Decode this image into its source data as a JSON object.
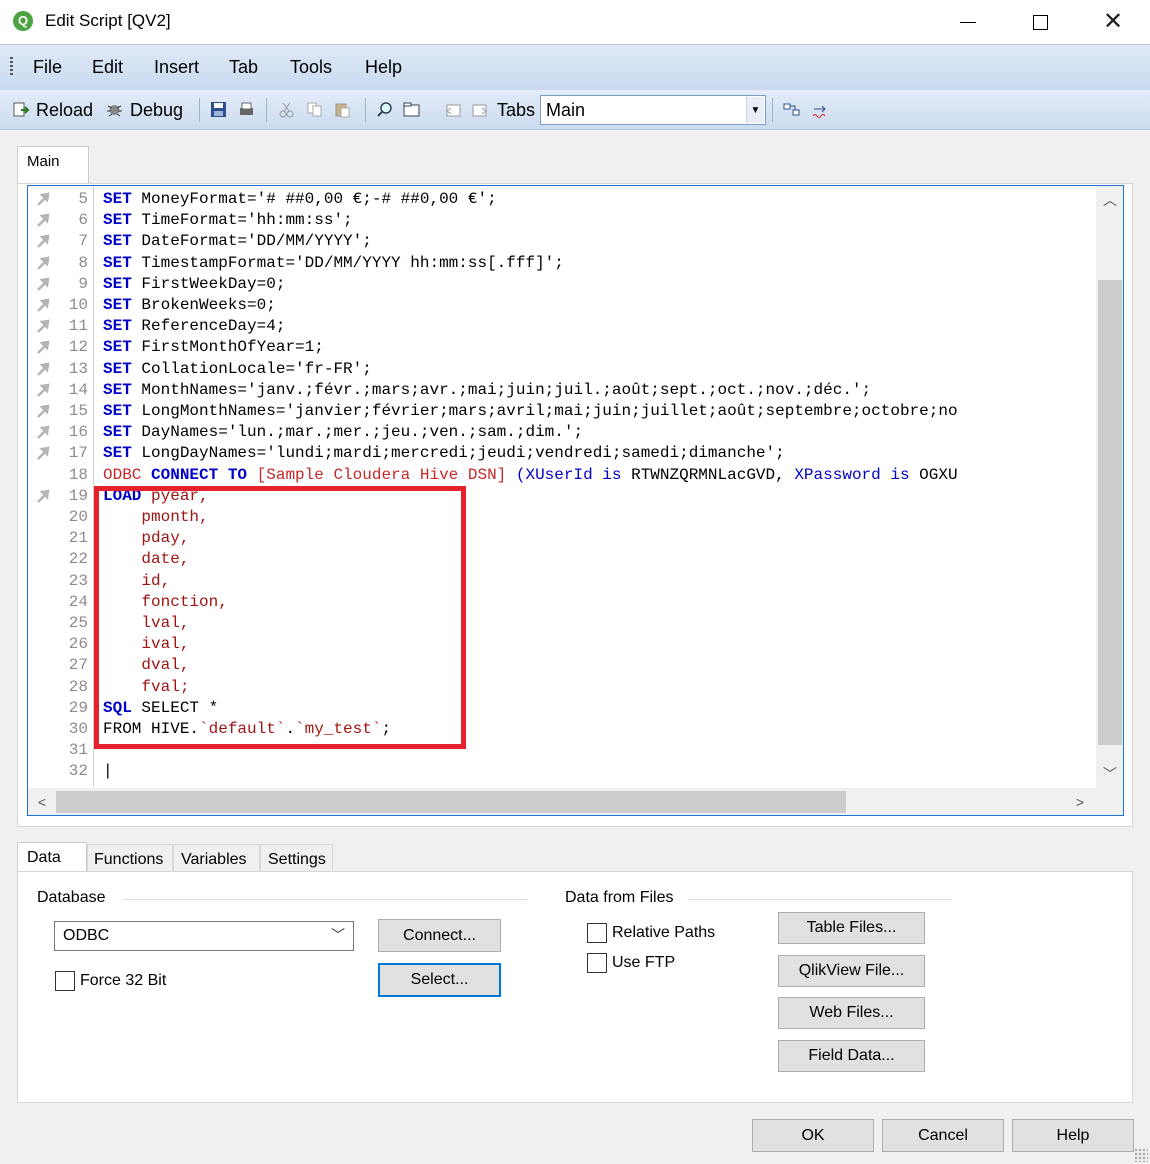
{
  "window": {
    "title": "Edit Script [QV2]",
    "app_icon_glyph": "Q"
  },
  "menu": [
    "File",
    "Edit",
    "Insert",
    "Tab",
    "Tools",
    "Help"
  ],
  "toolbar": {
    "reload_label": "Reload",
    "debug_label": "Debug",
    "tabs_label": "Tabs",
    "tab_select_value": "Main"
  },
  "editor": {
    "active_tab": "Main",
    "lines": [
      {
        "n": "5",
        "parts": [
          [
            "kw",
            "SET"
          ],
          [
            "plain",
            " MoneyFormat='# ##0,00 €;-# ##0,00 €';"
          ]
        ]
      },
      {
        "n": "6",
        "parts": [
          [
            "kw",
            "SET"
          ],
          [
            "plain",
            " TimeFormat='hh:mm:ss';"
          ]
        ]
      },
      {
        "n": "7",
        "parts": [
          [
            "kw",
            "SET"
          ],
          [
            "plain",
            " DateFormat='DD/MM/YYYY';"
          ]
        ]
      },
      {
        "n": "8",
        "parts": [
          [
            "kw",
            "SET"
          ],
          [
            "plain",
            " TimestampFormat='DD/MM/YYYY hh:mm:ss[.fff]';"
          ]
        ]
      },
      {
        "n": "9",
        "parts": [
          [
            "kw",
            "SET"
          ],
          [
            "plain",
            " FirstWeekDay=0;"
          ]
        ]
      },
      {
        "n": "10",
        "parts": [
          [
            "kw",
            "SET"
          ],
          [
            "plain",
            " BrokenWeeks=0;"
          ]
        ]
      },
      {
        "n": "11",
        "parts": [
          [
            "kw",
            "SET"
          ],
          [
            "plain",
            " ReferenceDay=4;"
          ]
        ]
      },
      {
        "n": "12",
        "parts": [
          [
            "kw",
            "SET"
          ],
          [
            "plain",
            " FirstMonthOfYear=1;"
          ]
        ]
      },
      {
        "n": "13",
        "parts": [
          [
            "kw",
            "SET"
          ],
          [
            "plain",
            " CollationLocale='fr-FR';"
          ]
        ]
      },
      {
        "n": "14",
        "parts": [
          [
            "kw",
            "SET"
          ],
          [
            "plain",
            " MonthNames='janv.;févr.;mars;avr.;mai;juin;juil.;août;sept.;oct.;nov.;déc.';"
          ]
        ]
      },
      {
        "n": "15",
        "parts": [
          [
            "kw",
            "SET"
          ],
          [
            "plain",
            " LongMonthNames='janvier;février;mars;avril;mai;juin;juillet;août;septembre;octobre;no"
          ]
        ]
      },
      {
        "n": "16",
        "parts": [
          [
            "kw",
            "SET"
          ],
          [
            "plain",
            " DayNames='lun.;mar.;mer.;jeu.;ven.;sam.;dim.';"
          ]
        ]
      },
      {
        "n": "17",
        "parts": [
          [
            "kw",
            "SET"
          ],
          [
            "plain",
            " LongDayNames='lundi;mardi;mercredi;jeudi;vendredi;samedi;dimanche';"
          ]
        ]
      },
      {
        "n": "18",
        "parts": [
          [
            "red",
            "ODBC "
          ],
          [
            "kw",
            "CONNECT TO"
          ],
          [
            "red",
            " [Sample Cloudera Hive DSN] "
          ],
          [
            "kwr",
            "(XUserId is "
          ],
          [
            "plain",
            "RTWNZQRMNLacGVD, "
          ],
          [
            "kwr",
            "XPassword is "
          ],
          [
            "plain",
            "OGXU"
          ]
        ]
      },
      {
        "n": "19",
        "parts": [
          [
            "kw",
            "LOAD"
          ],
          [
            "fld",
            " pyear,"
          ]
        ]
      },
      {
        "n": "20",
        "parts": [
          [
            "fld",
            "    pmonth,"
          ]
        ]
      },
      {
        "n": "21",
        "parts": [
          [
            "fld",
            "    pday,"
          ]
        ]
      },
      {
        "n": "22",
        "parts": [
          [
            "fld",
            "    date,"
          ]
        ]
      },
      {
        "n": "23",
        "parts": [
          [
            "fld",
            "    id,"
          ]
        ]
      },
      {
        "n": "24",
        "parts": [
          [
            "fld",
            "    fonction,"
          ]
        ]
      },
      {
        "n": "25",
        "parts": [
          [
            "fld",
            "    lval,"
          ]
        ]
      },
      {
        "n": "26",
        "parts": [
          [
            "fld",
            "    ival,"
          ]
        ]
      },
      {
        "n": "27",
        "parts": [
          [
            "fld",
            "    dval,"
          ]
        ]
      },
      {
        "n": "28",
        "parts": [
          [
            "fld",
            "    fval;"
          ]
        ]
      },
      {
        "n": "29",
        "parts": [
          [
            "kw",
            "SQL"
          ],
          [
            "plain",
            " SELECT *"
          ]
        ]
      },
      {
        "n": "30",
        "parts": [
          [
            "plain",
            "FROM HIVE."
          ],
          [
            "fld",
            "`default`"
          ],
          [
            "plain",
            "."
          ],
          [
            "fld",
            "`my_test`"
          ],
          [
            "plain",
            ";"
          ]
        ]
      },
      {
        "n": "31",
        "parts": []
      },
      {
        "n": "32",
        "parts": [
          [
            "plain",
            "|"
          ]
        ]
      }
    ],
    "marker_lines": [
      "5",
      "6",
      "7",
      "8",
      "9",
      "10",
      "11",
      "12",
      "13",
      "14",
      "15",
      "16",
      "17",
      "19"
    ]
  },
  "lower_tabs": [
    "Data",
    "Functions",
    "Variables",
    "Settings"
  ],
  "data_panel": {
    "database_label": "Database",
    "database_value": "ODBC",
    "connect_label": "Connect...",
    "select_label": "Select...",
    "force32_label": "Force 32 Bit",
    "files_label": "Data from Files",
    "relative_paths_label": "Relative Paths",
    "use_ftp_label": "Use FTP",
    "table_files_label": "Table Files...",
    "qlikview_file_label": "QlikView File...",
    "web_files_label": "Web Files...",
    "field_data_label": "Field Data..."
  },
  "footer": {
    "ok_label": "OK",
    "cancel_label": "Cancel",
    "help_label": "Help"
  },
  "colors": {
    "highlight": "#e4212c",
    "keyword": "#0000c8",
    "field": "#a01414",
    "accent": "#0078d7"
  }
}
